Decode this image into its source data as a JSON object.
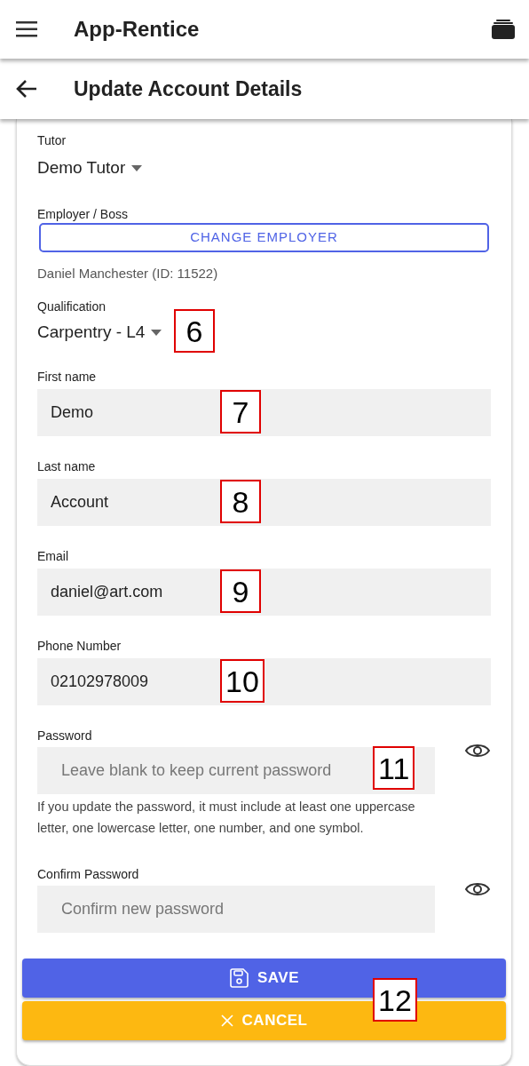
{
  "app_bar": {
    "title": "App-Rentice"
  },
  "page_header": {
    "title": "Update Account Details"
  },
  "form": {
    "tutor": {
      "label": "Tutor",
      "value": "Demo Tutor"
    },
    "employer": {
      "label": "Employer / Boss",
      "button": "CHANGE EMPLOYER",
      "current": "Daniel Manchester (ID: 11522)"
    },
    "qualification": {
      "label": "Qualification",
      "value": "Carpentry - L4",
      "marker": "6"
    },
    "fields": [
      {
        "kind": "text",
        "label": "First name",
        "value": "Demo",
        "marker": "7"
      },
      {
        "kind": "text",
        "label": "Last name",
        "value": "Account",
        "marker": "8"
      },
      {
        "kind": "text",
        "label": "Email",
        "value": "daniel@art.com",
        "marker": "9"
      },
      {
        "kind": "text",
        "label": "Phone Number",
        "value": "02102978009",
        "marker": "10"
      },
      {
        "kind": "password",
        "label": "Password",
        "placeholder": "Leave blank to keep current password",
        "marker": "11",
        "help": "If you update the password, it must include at least one uppercase letter, one lowercase letter, one number, and one symbol."
      },
      {
        "kind": "password",
        "label": "Confirm Password",
        "placeholder": "Confirm new password"
      }
    ],
    "buttons": [
      {
        "kind": "save",
        "label": "SAVE"
      },
      {
        "kind": "cancel",
        "label": "CANCEL"
      }
    ],
    "buttons_marker": "12"
  }
}
